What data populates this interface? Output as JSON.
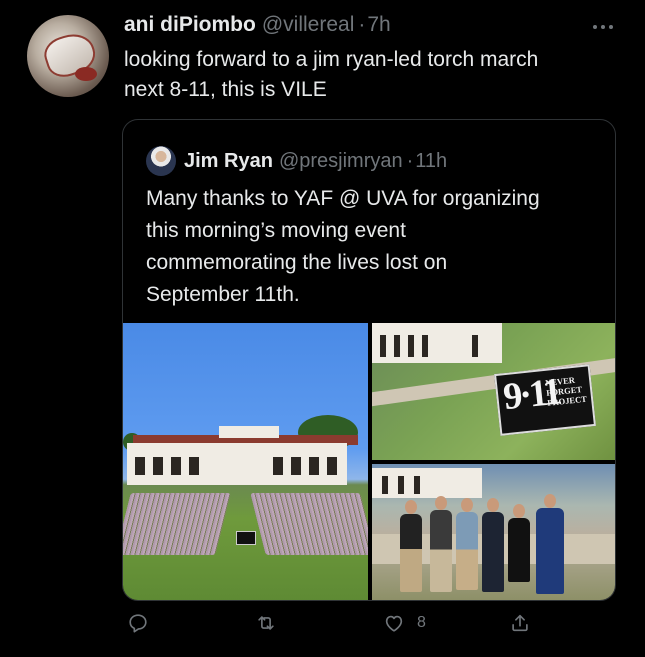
{
  "tweet": {
    "author_name": "ani diPiombo",
    "author_handle": "@villereal",
    "separator": "·",
    "time": "7h",
    "more_icon": "more-icon",
    "text_lines": [
      "looking forward to a jim ryan-led torch march",
      "next 8-11, this is VILE"
    ]
  },
  "quoted": {
    "author_name": "Jim Ryan",
    "author_handle": "@presjimryan",
    "separator": "·",
    "time": "11h",
    "text_lines": [
      "Many thanks to YAF @ UVA for organizing",
      "this morning’s moving event",
      "commemorating the lives lost on",
      "September 11th."
    ],
    "sign": {
      "numerals": "9·11",
      "lines": [
        "NEVER",
        "FORGET",
        "PROJECT"
      ]
    }
  },
  "actions": {
    "reply_icon": "reply-icon",
    "retweet_icon": "retweet-icon",
    "like_icon": "like-icon",
    "like_count": "8",
    "share_icon": "share-icon"
  },
  "colors": {
    "background": "#000000",
    "text": "#e7e9ea",
    "muted": "#71767b",
    "border": "#2f3336"
  }
}
